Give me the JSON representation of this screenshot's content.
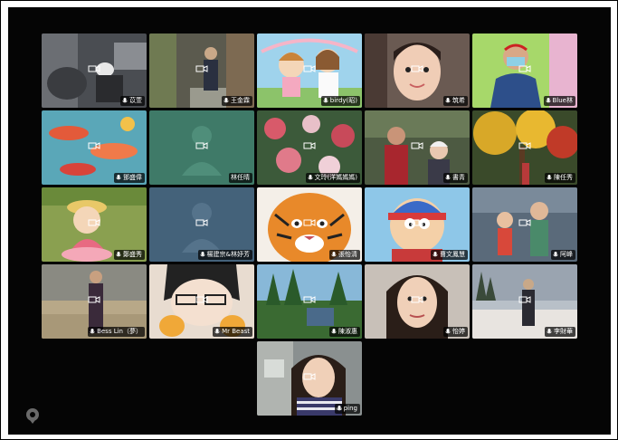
{
  "window": {
    "title": ""
  },
  "participants": [
    {
      "name": "苡萱"
    },
    {
      "name": "王金霖"
    },
    {
      "name": "birdy(昭)"
    },
    {
      "name": "筑希"
    },
    {
      "name": "Blue林"
    },
    {
      "name": "鄧盛偉"
    },
    {
      "name": "林任晴"
    },
    {
      "name": "文玲(洋媽媽媽)"
    },
    {
      "name": "書青"
    },
    {
      "name": "陳任秀"
    },
    {
      "name": "鄭盛秀"
    },
    {
      "name": "楊建宗&林妤芳"
    },
    {
      "name": "張怡清"
    },
    {
      "name": "曹文鳳慧"
    },
    {
      "name": "阿峰"
    },
    {
      "name": "Bess Lin（夢）"
    },
    {
      "name": "Mr Beast"
    },
    {
      "name": "陳淑惠"
    },
    {
      "name": "怡婷"
    },
    {
      "name": "李財華"
    },
    {
      "name": "ping"
    }
  ],
  "colors": {
    "stage_bg": "#050505",
    "label_bg": "#000000"
  },
  "icons": {
    "mic": "mic-icon",
    "camera": "camera-icon",
    "app": "app-logo-icon"
  }
}
